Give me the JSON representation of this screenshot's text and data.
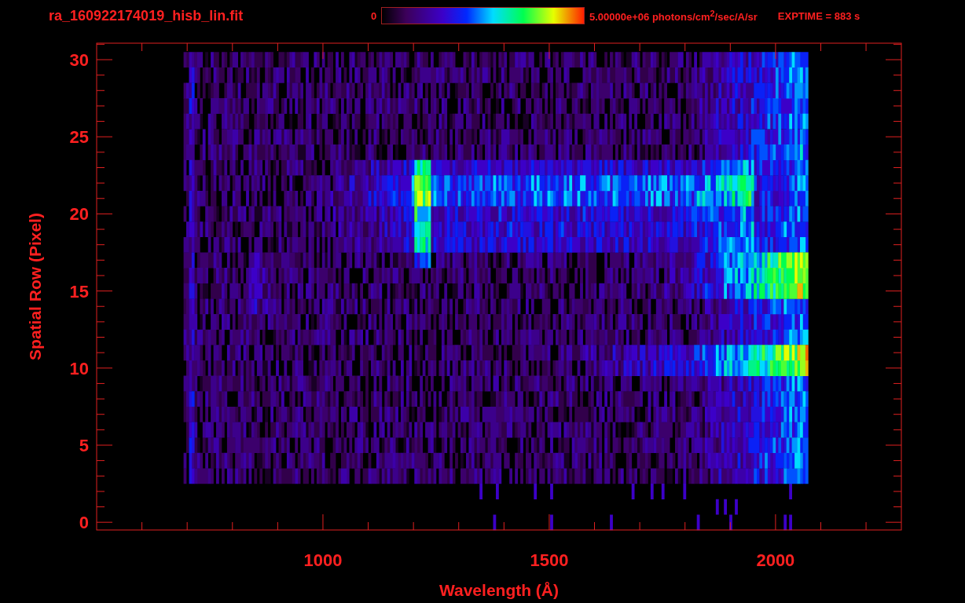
{
  "title": "ra_160922174019_hisb_lin.fit",
  "colorbar": {
    "min_label": "0",
    "max_label": "5.00000e+06 photons/cm$^{2}$/sec/A/sr"
  },
  "exposure": "EXPTIME = 883 s",
  "plot": {
    "xlabel": "Wavelength (Å)",
    "ylabel": "Spatial Row (Pixel)",
    "xticks": [
      "1000",
      "1500",
      "2000"
    ],
    "yticks": [
      "30",
      "25",
      "20",
      "15",
      "10",
      "5",
      "0"
    ]
  }
}
